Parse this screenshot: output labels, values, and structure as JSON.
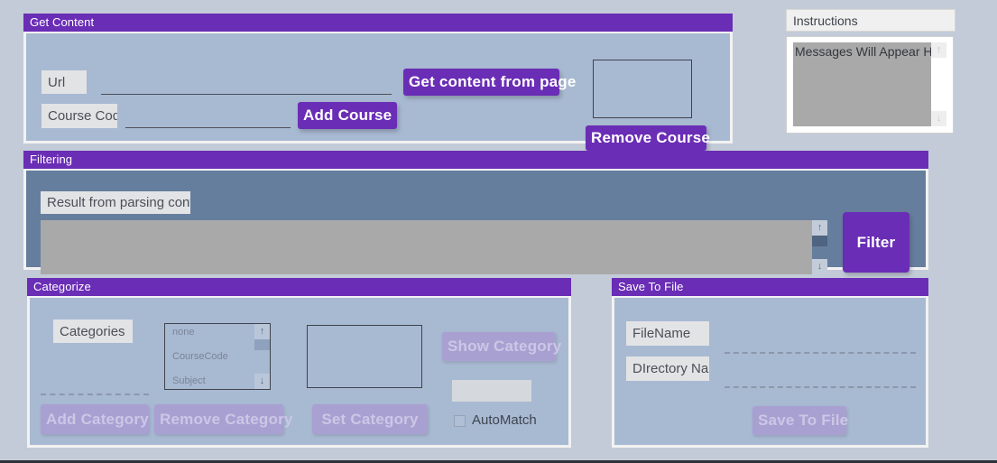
{
  "theme": {
    "accent": "#6a2db5",
    "page_bg": "#c3cbd8",
    "panel_bg": "#a8b9d2",
    "panel_bg_slate": "#667e9e",
    "disabled_button": "#a9a0d2",
    "textarea_bg": "#a9a9a9"
  },
  "get_content": {
    "title": "Get Content",
    "url_label": "Url",
    "url_value": "",
    "url_placeholder": "",
    "course_code_label": "Course Code",
    "course_code_value": "",
    "course_code_placeholder": "",
    "get_content_button": "Get content from page",
    "add_course_button": "Add Course",
    "remove_course_button": "Remove Course",
    "course_list_items": []
  },
  "instructions": {
    "label": "Instructions",
    "message": "Messages Will Appear Here"
  },
  "filtering": {
    "title": "Filtering",
    "result_label": "Result from parsing content",
    "result_value": "",
    "filter_button": "Filter"
  },
  "categorize": {
    "title": "Categorize",
    "categories_label": "Categories",
    "category_input_value": "",
    "category_list": [
      "none",
      "CourseCode",
      "Subject"
    ],
    "add_category_button": "Add Category",
    "remove_category_button": "Remove Category",
    "set_category_button": "Set Category",
    "show_category_button": "Show Category",
    "category_display_value": "",
    "automatch_label": "AutoMatch",
    "automatch_checked": false,
    "selected_items": []
  },
  "save_to_file": {
    "title": "Save To File",
    "filename_label": "FileName",
    "filename_value": "",
    "directory_label": "DIrectory Name",
    "directory_value": "",
    "save_button": "Save To File"
  },
  "scroll_icons": {
    "up": "↑",
    "down": "↓"
  }
}
